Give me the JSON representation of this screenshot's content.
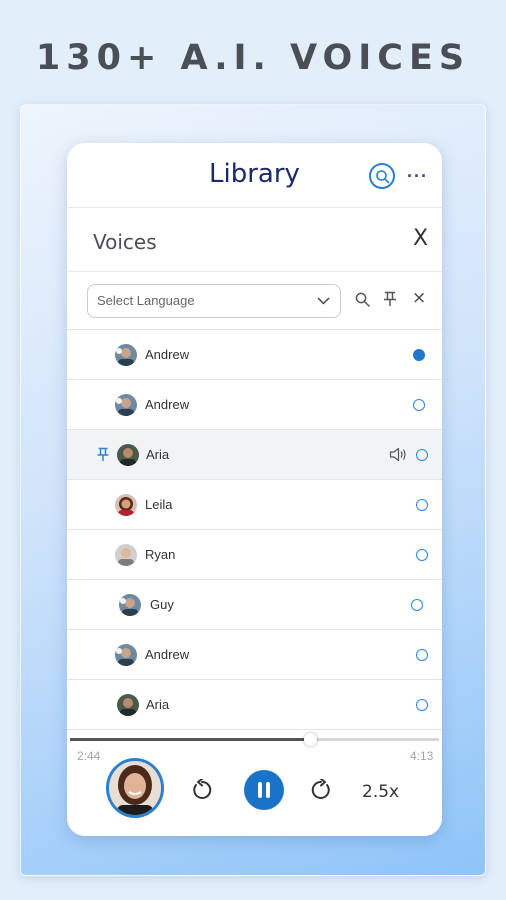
{
  "headline": "130+ A.I. VOICES",
  "header": {
    "title": "Library",
    "search_icon": "search-icon",
    "more_icon": "more-horizontal-icon",
    "more_label": "···"
  },
  "voices_panel": {
    "title": "Voices",
    "close_label": "X"
  },
  "filter": {
    "language_placeholder": "Select Language",
    "search_icon": "search-icon",
    "pin_icon": "pin-icon",
    "clear_label": "×"
  },
  "voices": [
    {
      "name": "Andrew",
      "selected": true,
      "pinned": false,
      "playing": false
    },
    {
      "name": "Andrew",
      "selected": false,
      "pinned": false,
      "playing": false
    },
    {
      "name": "Aria",
      "selected": false,
      "pinned": true,
      "playing": true
    },
    {
      "name": "Leila",
      "selected": false,
      "pinned": false,
      "playing": false
    },
    {
      "name": "Ryan",
      "selected": false,
      "pinned": false,
      "playing": false
    },
    {
      "name": "Guy",
      "selected": false,
      "pinned": false,
      "playing": false
    },
    {
      "name": "Andrew",
      "selected": false,
      "pinned": false,
      "playing": false
    },
    {
      "name": "Aria",
      "selected": false,
      "pinned": false,
      "playing": false
    }
  ],
  "player": {
    "elapsed": "2:44",
    "total": "4:13",
    "progress": 0.65,
    "rewind_icon": "rewind-icon",
    "pause_icon": "pause-icon",
    "forward_icon": "forward-icon",
    "speed": "2.5x"
  },
  "colors": {
    "accent": "#1a73c9",
    "title": "#1c2a6b"
  }
}
